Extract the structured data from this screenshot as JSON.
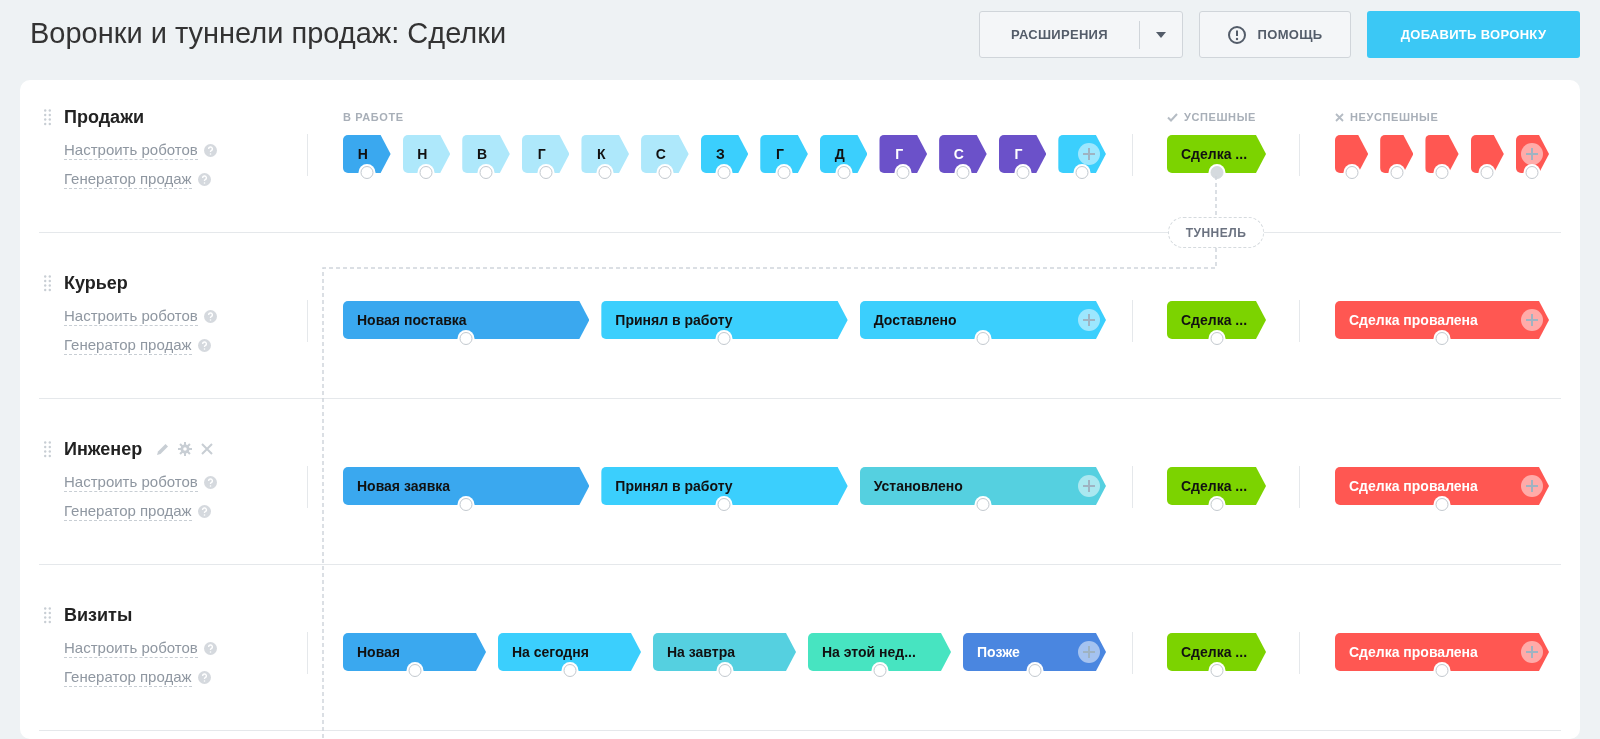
{
  "page": {
    "title": "Воронки и туннели продаж: Сделки"
  },
  "toolbar": {
    "extensions_button": "РАСШИРЕНИЯ",
    "help_button": "ПОМОЩЬ",
    "add_button": "ДОБАВИТЬ ВОРОНКУ"
  },
  "section_labels": {
    "work": "В РАБОТЕ",
    "success": "УСПЕШНЫЕ",
    "fail": "НЕУСПЕШНЫЕ"
  },
  "tunnel": {
    "label": "ТУННЕЛЬ"
  },
  "funnels": [
    {
      "name": "Продажи",
      "actions_visible": false,
      "links": [
        "Настроить роботов",
        "Генератор продаж"
      ],
      "work_stages": [
        {
          "title": "Н",
          "color": "#3aa8ef"
        },
        {
          "title": "Н",
          "color": "#aee8fb"
        },
        {
          "title": "В",
          "color": "#aee8fb"
        },
        {
          "title": "Г",
          "color": "#aee8fb"
        },
        {
          "title": "К",
          "color": "#aee8fb"
        },
        {
          "title": "С",
          "color": "#aee8fb"
        },
        {
          "title": "З",
          "color": "#3bcffd"
        },
        {
          "title": "Г",
          "color": "#3bcffd"
        },
        {
          "title": "Д",
          "color": "#3bcffd"
        },
        {
          "title": "Г",
          "color": "#6b51c9"
        },
        {
          "title": "С",
          "color": "#6b51c9"
        },
        {
          "title": "Г",
          "color": "#6b51c9"
        },
        {
          "color": "#3bcffd"
        }
      ],
      "success_stages": [
        {
          "title": "Сделка ...",
          "color": "#7cd300",
          "linked": true
        }
      ],
      "fail_stages": [
        {
          "color": "#ff5752"
        },
        {
          "color": "#ff5752"
        },
        {
          "color": "#ff5752"
        },
        {
          "color": "#ff5752"
        },
        {
          "color": "#ff5752"
        }
      ]
    },
    {
      "name": "Курьер",
      "actions_visible": false,
      "links": [
        "Настроить роботов",
        "Генератор продаж"
      ],
      "work_stages": [
        {
          "title": "Новая поставка",
          "color": "#3aa8ef"
        },
        {
          "title": "Принял в работу",
          "color": "#3bcffd"
        },
        {
          "title": "Доставлено",
          "color": "#3bcffd"
        }
      ],
      "success_stages": [
        {
          "title": "Сделка ...",
          "color": "#7cd300",
          "linked": false
        }
      ],
      "fail_stages": [
        {
          "title": "Сделка провалена",
          "color": "#ff5752"
        }
      ]
    },
    {
      "name": "Инженер",
      "actions_visible": true,
      "links": [
        "Настроить роботов",
        "Генератор продаж"
      ],
      "work_stages": [
        {
          "title": "Новая заявка",
          "color": "#3aa8ef"
        },
        {
          "title": "Принял в работу",
          "color": "#3bcffd"
        },
        {
          "title": "Установлено",
          "color": "#55d0e0"
        }
      ],
      "success_stages": [
        {
          "title": "Сделка ...",
          "color": "#7cd300",
          "linked": false
        }
      ],
      "fail_stages": [
        {
          "title": "Сделка провалена",
          "color": "#ff5752"
        }
      ]
    },
    {
      "name": "Визиты",
      "actions_visible": false,
      "links": [
        "Настроить роботов",
        "Генератор продаж"
      ],
      "work_stages": [
        {
          "title": "Новая",
          "color": "#3aa8ef"
        },
        {
          "title": "На сегодня",
          "color": "#3bcffd"
        },
        {
          "title": "На завтра",
          "color": "#55d0e0"
        },
        {
          "title": "На этой нед...",
          "color": "#47e4c1"
        },
        {
          "title": "Позже",
          "color": "#4a86e0"
        }
      ],
      "success_stages": [
        {
          "title": "Сделка ...",
          "color": "#7cd300",
          "linked": false
        }
      ],
      "fail_stages": [
        {
          "title": "Сделка провалена",
          "color": "#ff5752"
        }
      ]
    }
  ]
}
